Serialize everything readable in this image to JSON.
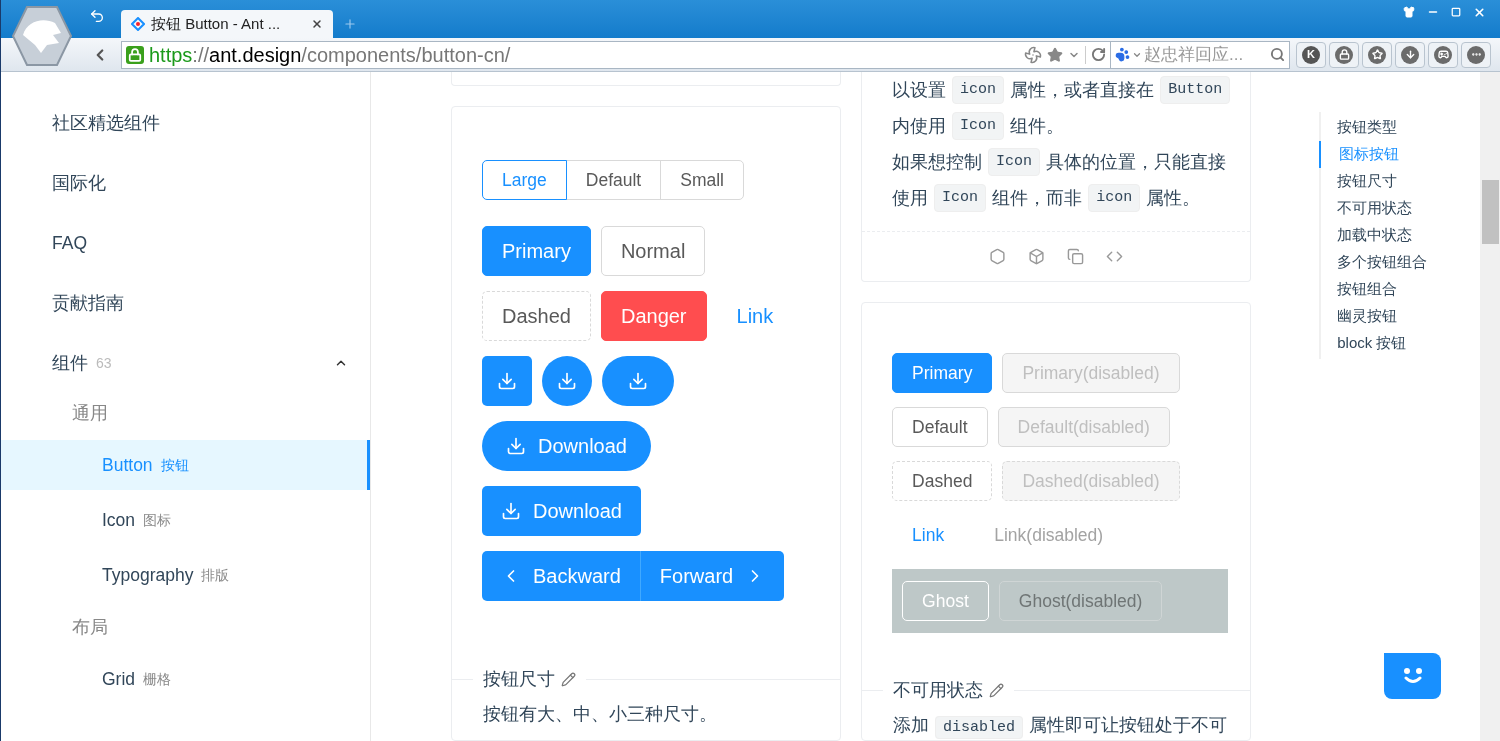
{
  "browser": {
    "tab": {
      "title": "按钮 Button - Ant ..."
    },
    "url": {
      "scheme": "https",
      "separator": "://",
      "host": "ant.design",
      "path": "/components/button-cn/"
    },
    "search_placeholder": "赵忠祥回应...",
    "extensions": [
      {
        "kind": "letter",
        "label": "K"
      },
      {
        "kind": "lock"
      },
      {
        "kind": "star"
      },
      {
        "kind": "download"
      },
      {
        "kind": "game"
      },
      {
        "kind": "more"
      }
    ]
  },
  "sidebar": {
    "items": [
      {
        "kind": "item",
        "label": "社区精选组件"
      },
      {
        "kind": "item",
        "label": "国际化"
      },
      {
        "kind": "item",
        "label": "FAQ"
      },
      {
        "kind": "item",
        "label": "贡献指南"
      },
      {
        "kind": "submenu",
        "label": "组件",
        "count": "63",
        "expanded": true,
        "children": [
          {
            "kind": "group",
            "label": "通用",
            "children": [
              {
                "label": "Button",
                "sublabel": "按钮",
                "selected": true
              },
              {
                "label": "Icon",
                "sublabel": "图标",
                "selected": false
              },
              {
                "label": "Typography",
                "sublabel": "排版",
                "selected": false
              }
            ]
          },
          {
            "kind": "group",
            "label": "布局",
            "children": [
              {
                "label": "Grid",
                "sublabel": "栅格",
                "selected": false
              }
            ]
          }
        ]
      }
    ]
  },
  "size_demo": {
    "size_options": [
      {
        "label": "Large",
        "selected": true
      },
      {
        "label": "Default",
        "selected": false
      },
      {
        "label": "Small",
        "selected": false
      }
    ],
    "button_rows": [
      [
        {
          "kind": "primary",
          "label": "Primary"
        },
        {
          "kind": "default",
          "label": "Normal"
        }
      ],
      [
        {
          "kind": "dashed",
          "label": "Dashed"
        },
        {
          "kind": "danger",
          "label": "Danger"
        },
        {
          "kind": "link",
          "label": "Link"
        }
      ],
      [
        {
          "kind": "icon-square"
        },
        {
          "kind": "icon-circle"
        },
        {
          "kind": "icon-round"
        }
      ],
      [
        {
          "kind": "icon-text-round",
          "label": "Download"
        }
      ],
      [
        {
          "kind": "icon-text-square",
          "label": "Download"
        }
      ],
      [
        {
          "kind": "group",
          "items": [
            {
              "kind": "prev",
              "label": "Backward"
            },
            {
              "kind": "next",
              "label": "Forward"
            }
          ]
        }
      ]
    ],
    "section": {
      "title": "按钮尺寸",
      "description": "按钮有大、中、小三种尺寸。"
    }
  },
  "icon_demo": {
    "lines": [
      [
        {
          "kind": "text",
          "text": "以设置"
        },
        {
          "kind": "code",
          "text": "icon"
        },
        {
          "kind": "text",
          "text": "属性，或者直接在"
        },
        {
          "kind": "code",
          "text": "Button"
        }
      ],
      [
        {
          "kind": "text",
          "text": "内使用"
        },
        {
          "kind": "code",
          "text": "Icon"
        },
        {
          "kind": "text",
          "text": "组件。"
        }
      ],
      [
        {
          "kind": "text",
          "text": "如果想控制"
        },
        {
          "kind": "code",
          "text": "Icon"
        },
        {
          "kind": "text",
          "text": "具体的位置，只能直接"
        }
      ],
      [
        {
          "kind": "text",
          "text": "使用"
        },
        {
          "kind": "code",
          "text": "Icon"
        },
        {
          "kind": "text",
          "text": "组件，而非"
        },
        {
          "kind": "code",
          "text": "icon"
        },
        {
          "kind": "text",
          "text": "属性。"
        }
      ]
    ]
  },
  "disabled_demo": {
    "rows": [
      [
        {
          "kind": "primary",
          "label": "Primary",
          "disabled": false
        },
        {
          "kind": "primary",
          "label": "Primary(disabled)",
          "disabled": true
        }
      ],
      [
        {
          "kind": "default",
          "label": "Default",
          "disabled": false
        },
        {
          "kind": "default",
          "label": "Default(disabled)",
          "disabled": true
        }
      ],
      [
        {
          "kind": "dashed",
          "label": "Dashed",
          "disabled": false
        },
        {
          "kind": "dashed",
          "label": "Dashed(disabled)",
          "disabled": true
        }
      ],
      [
        {
          "kind": "link",
          "label": "Link",
          "disabled": false
        },
        {
          "kind": "link",
          "label": "Link(disabled)",
          "disabled": true
        }
      ]
    ],
    "ghost_row": [
      {
        "label": "Ghost",
        "disabled": false
      },
      {
        "label": "Ghost(disabled)",
        "disabled": true
      }
    ],
    "section": {
      "title": "不可用状态",
      "description": [
        {
          "kind": "text",
          "text": "添加"
        },
        {
          "kind": "code",
          "text": "disabled"
        },
        {
          "kind": "text",
          "text": "属性即可让按钮处于不可"
        }
      ]
    }
  },
  "toc": {
    "items": [
      {
        "label": "按钮类型",
        "selected": false
      },
      {
        "label": "图标按钮",
        "selected": true
      },
      {
        "label": "按钮尺寸",
        "selected": false
      },
      {
        "label": "不可用状态",
        "selected": false
      },
      {
        "label": "加载中状态",
        "selected": false
      },
      {
        "label": "多个按钮组合",
        "selected": false
      },
      {
        "label": "按钮组合",
        "selected": false
      },
      {
        "label": "幽灵按钮",
        "selected": false
      },
      {
        "label": "block 按钮",
        "selected": false
      }
    ]
  }
}
